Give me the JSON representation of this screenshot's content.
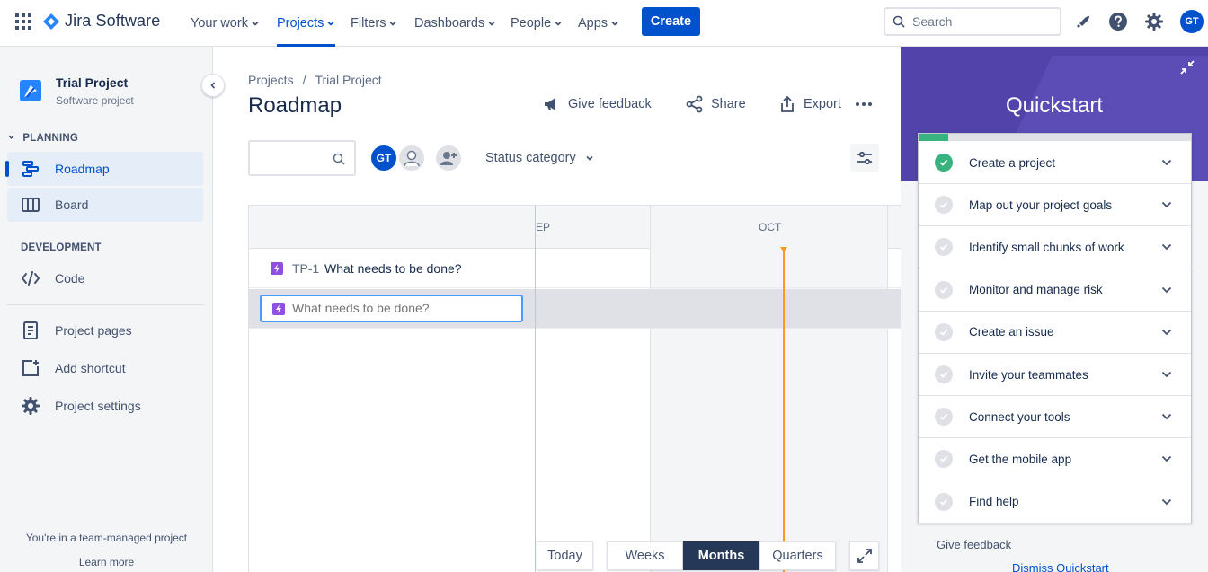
{
  "app": {
    "name": "Jira Software"
  },
  "nav": {
    "items": [
      {
        "label": "Your work",
        "active": false
      },
      {
        "label": "Projects",
        "active": true
      },
      {
        "label": "Filters",
        "active": false
      },
      {
        "label": "Dashboards",
        "active": false
      },
      {
        "label": "People",
        "active": false
      },
      {
        "label": "Apps",
        "active": false
      }
    ],
    "create_label": "Create",
    "search_placeholder": "Search",
    "user_initials": "GT"
  },
  "sidebar": {
    "project_name": "Trial Project",
    "project_type": "Software project",
    "planning_header": "PLANNING",
    "development_header": "DEVELOPMENT",
    "items": {
      "roadmap": "Roadmap",
      "board": "Board",
      "code": "Code",
      "project_pages": "Project pages",
      "add_shortcut": "Add shortcut",
      "project_settings": "Project settings"
    },
    "footer_text": "You're in a team-managed project",
    "learn_more": "Learn more"
  },
  "main": {
    "breadcrumb": [
      "Projects",
      "/",
      "Trial Project"
    ],
    "title": "Roadmap",
    "actions": {
      "feedback": "Give feedback",
      "share": "Share",
      "export": "Export"
    },
    "avatar_initials": "GT",
    "status_category": "Status category",
    "timeline": {
      "months": [
        "EP",
        "OCT"
      ],
      "issues": [
        {
          "key": "TP-1",
          "summary": "What needs to be done?"
        }
      ],
      "edit_value": "What needs to be done?"
    },
    "controls": {
      "today": "Today",
      "weeks": "Weeks",
      "months": "Months",
      "quarters": "Quarters"
    }
  },
  "quickstart": {
    "title": "Quickstart",
    "progress_percent": 11,
    "items": [
      {
        "label": "Create a project",
        "done": true
      },
      {
        "label": "Map out your project goals",
        "done": false
      },
      {
        "label": "Identify small chunks of work",
        "done": false
      },
      {
        "label": "Monitor and manage risk",
        "done": false
      },
      {
        "label": "Create an issue",
        "done": false
      },
      {
        "label": "Invite your teammates",
        "done": false
      },
      {
        "label": "Connect your tools",
        "done": false
      },
      {
        "label": "Get the mobile app",
        "done": false
      },
      {
        "label": "Find help",
        "done": false
      }
    ],
    "give_feedback": "Give feedback",
    "dismiss": "Dismiss Quickstart"
  },
  "colors": {
    "brand": "#0052cc",
    "quickstart_purple": "#5243aa",
    "success": "#36b37e",
    "today_line": "#ff991f",
    "issue_type": "#904ee2"
  }
}
